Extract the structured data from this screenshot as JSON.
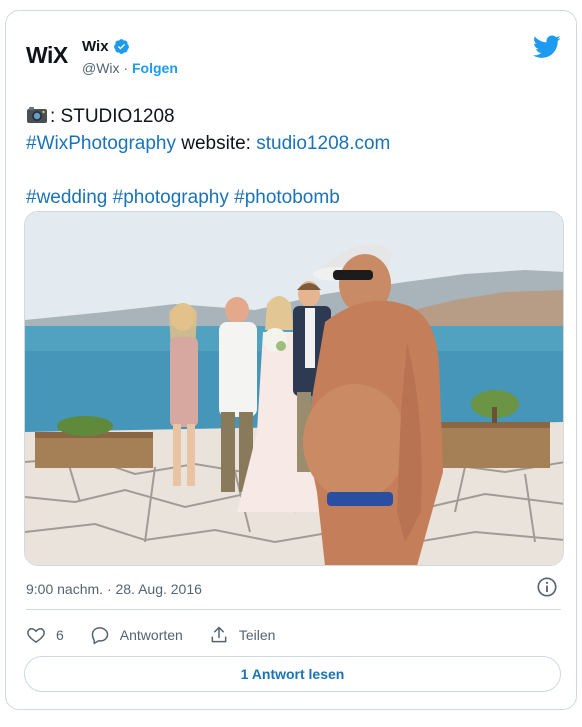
{
  "header": {
    "logo_text": "WiX",
    "user_name": "Wix",
    "handle": "@Wix",
    "separator": "·",
    "follow_label": "Folgen"
  },
  "tweet": {
    "line1_text": ": STUDIO1208",
    "hashtag_photo": "#WixPhotography",
    "website_label": " website: ",
    "website_link": "studio1208.com",
    "hashtags": [
      "#wedding",
      "#photography",
      "#photobomb"
    ]
  },
  "photo": {
    "description_icon": "photo",
    "colors": {
      "sky": "#dfe8ee",
      "sea": "#3f8fb3",
      "mountain": "#9aa7ad",
      "ground": "#e8e2db",
      "stone_lines": "#8f8a84"
    }
  },
  "meta": {
    "timestamp": "9:00 nachm. · 28. Aug. 2016"
  },
  "actions": {
    "like_count": "6",
    "reply_label": "Antworten",
    "share_label": "Teilen"
  },
  "read_replies_label": "1 Antwort lesen",
  "colors": {
    "accent": "#1d9bf0",
    "link": "#1b73b7",
    "muted": "#536471",
    "border": "#cfd9de"
  }
}
